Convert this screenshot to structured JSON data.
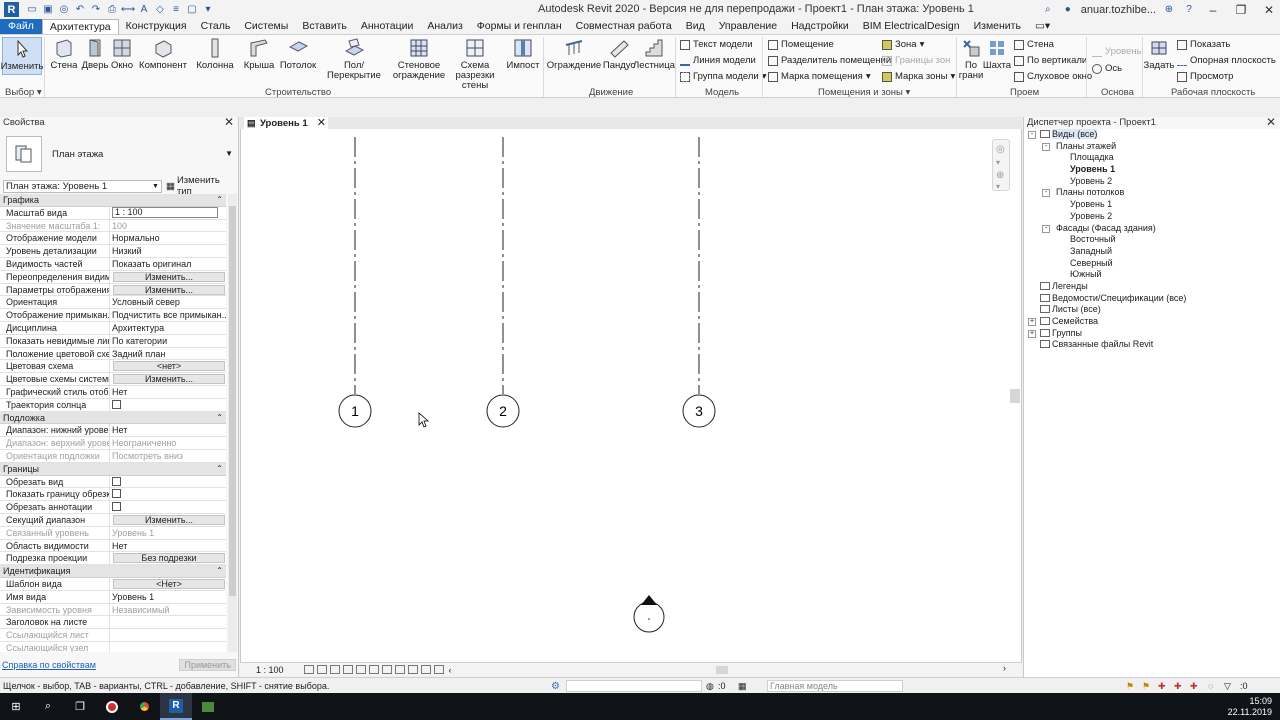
{
  "window": {
    "title": "Autodesk Revit 2020 - Версия не для перепродажи - Проект1 - План этажа: Уровень 1",
    "user": "anuar.tozhibe..."
  },
  "tabs": [
    "Файл",
    "Архитектура",
    "Конструкция",
    "Сталь",
    "Системы",
    "Вставить",
    "Аннотации",
    "Анализ",
    "Формы и генплан",
    "Совместная работа",
    "Вид",
    "Управление",
    "Надстройки",
    "BIM ElectricalDesign",
    "Изменить"
  ],
  "ribbon": {
    "modify": "Изменить",
    "select_label": "Выбор",
    "build_buttons": [
      "Стена",
      "Дверь",
      "Окно",
      "Компонент",
      "Колонна",
      "Крыша",
      "Потолок",
      "Пол/Перекрытие",
      "Стеновое ограждение",
      "Схема разрезки стены",
      "Импост"
    ],
    "build_group": "Строительство",
    "move_buttons": [
      "Ограждение",
      "Пандус",
      "Лестница"
    ],
    "move_group": "Движение",
    "model_items": [
      "Текст модели",
      "Линия модели",
      "Группа модели"
    ],
    "model_group": "Модель",
    "rooms_items": [
      "Помещение",
      "Разделитель помещений",
      "Марка помещения"
    ],
    "rooms_items2": [
      "Зона",
      "Границы зон",
      "Марка зоны"
    ],
    "rooms_group": "Помещения и зоны",
    "opening_buttons": [
      "По грани",
      "Шахта"
    ],
    "opening_items": [
      "Стена",
      "По вертикали",
      "Слуховое окно"
    ],
    "opening_group": "Проем",
    "datum_items": [
      "Уровень",
      "Ось"
    ],
    "datum_group": "Основа",
    "workplane_button": "Задать",
    "workplane_items": [
      "Показать",
      "Опорная плоскость",
      "Просмотр"
    ],
    "workplane_group": "Рабочая плоскость"
  },
  "properties": {
    "header": "Свойства",
    "type_name": "План этажа",
    "instance": "План этажа: Уровень 1",
    "edit_type": "Изменить тип",
    "rows": [
      {
        "section": "Графика"
      },
      {
        "k": "Масштаб вида",
        "v": "1 : 100",
        "kind": "input"
      },
      {
        "k": "Значение масштаба    1:",
        "v": "100",
        "dis": true
      },
      {
        "k": "Отображение модели",
        "v": "Нормально"
      },
      {
        "k": "Уровень детализации",
        "v": "Низкий"
      },
      {
        "k": "Видимость частей",
        "v": "Показать оригинал"
      },
      {
        "k": "Переопределения видим...",
        "v": "Изменить...",
        "kind": "btn"
      },
      {
        "k": "Параметры отображения ...",
        "v": "Изменить...",
        "kind": "btn"
      },
      {
        "k": "Ориентация",
        "v": "Условный север"
      },
      {
        "k": "Отображение примыкан...",
        "v": "Подчистить все примыкан..."
      },
      {
        "k": "Дисциплина",
        "v": "Архитектура"
      },
      {
        "k": "Показать невидимые лин...",
        "v": "По категории"
      },
      {
        "k": "Положение цветовой схе...",
        "v": "Задний план"
      },
      {
        "k": "Цветовая схема",
        "v": "<нет>",
        "kind": "btn"
      },
      {
        "k": "Цветовые схемы системы",
        "v": "Изменить...",
        "kind": "btn"
      },
      {
        "k": "Графический стиль отобр...",
        "v": "Нет"
      },
      {
        "k": "Траектория солнца",
        "v": "",
        "kind": "cb"
      },
      {
        "section": "Подложка"
      },
      {
        "k": "Диапазон: нижний уровень",
        "v": "Нет"
      },
      {
        "k": "Диапазон: верхний уровен...",
        "v": "Неограниченно",
        "dis": true
      },
      {
        "k": "Ориентация подложки",
        "v": "Посмотреть вниз",
        "dis": true
      },
      {
        "section": "Границы"
      },
      {
        "k": "Обрезать вид",
        "v": "",
        "kind": "cb"
      },
      {
        "k": "Показать границу обрезки",
        "v": "",
        "kind": "cb"
      },
      {
        "k": "Обрезать аннотации",
        "v": "",
        "kind": "cb"
      },
      {
        "k": "Секущий диапазон",
        "v": "Изменить...",
        "kind": "btn"
      },
      {
        "k": "Связанный уровень",
        "v": "Уровень 1",
        "dis": true
      },
      {
        "k": "Область видимости",
        "v": "Нет"
      },
      {
        "k": "Подрезка проекции",
        "v": "Без подрезки",
        "kind": "btn"
      },
      {
        "section": "Идентификация"
      },
      {
        "k": "Шаблон вида",
        "v": "<Нет>",
        "kind": "btn"
      },
      {
        "k": "Имя вида",
        "v": "Уровень 1"
      },
      {
        "k": "Зависимость уровня",
        "v": "Независимый",
        "dis": true
      },
      {
        "k": "Заголовок на листе",
        "v": ""
      },
      {
        "k": "Ссылающийся лист",
        "v": "",
        "dis": true
      },
      {
        "k": "Ссылающийся узел",
        "v": "",
        "dis": true
      }
    ],
    "help_link": "Справка по свойствам",
    "apply": "Применить"
  },
  "view": {
    "tab": "Уровень 1",
    "grids": [
      "1",
      "2",
      "3"
    ],
    "scale": "1 : 100"
  },
  "browser": {
    "header": "Диспетчер проекта - Проект1",
    "nodes": [
      {
        "label": "Виды (все)",
        "level": 0,
        "tog": "-",
        "sel": true
      },
      {
        "label": "Планы этажей",
        "level": 1,
        "tog": "-"
      },
      {
        "label": "Площадка",
        "level": 2
      },
      {
        "label": "Уровень 1",
        "level": 2,
        "bold": true
      },
      {
        "label": "Уровень 2",
        "level": 2
      },
      {
        "label": "Планы потолков",
        "level": 1,
        "tog": "-"
      },
      {
        "label": "Уровень 1",
        "level": 2
      },
      {
        "label": "Уровень 2",
        "level": 2
      },
      {
        "label": "Фасады (Фасад здания)",
        "level": 1,
        "tog": "-"
      },
      {
        "label": "Восточный",
        "level": 2
      },
      {
        "label": "Западный",
        "level": 2
      },
      {
        "label": "Северный",
        "level": 2
      },
      {
        "label": "Южный",
        "level": 2
      },
      {
        "label": "Легенды",
        "level": 0,
        "icon": true
      },
      {
        "label": "Ведомости/Спецификации (все)",
        "level": 0,
        "icon": true
      },
      {
        "label": "Листы (все)",
        "level": 0,
        "icon": true
      },
      {
        "label": "Семейства",
        "level": 0,
        "tog": "+",
        "icon": true
      },
      {
        "label": "Группы",
        "level": 0,
        "tog": "+",
        "icon": true
      },
      {
        "label": "Связанные файлы Revit",
        "level": 0,
        "icon": true
      }
    ]
  },
  "status": {
    "text": "Щелчок - выбор, TAB - варианты, CTRL - добавление, SHIFT - снятие выбора.",
    "workset_value": ":0",
    "model": "Главная модель"
  },
  "taskbar": {
    "time": "15:09",
    "date": "22.11.2019"
  },
  "colors": {
    "accent": "#1f6bbf",
    "taskbar": "#101418"
  }
}
